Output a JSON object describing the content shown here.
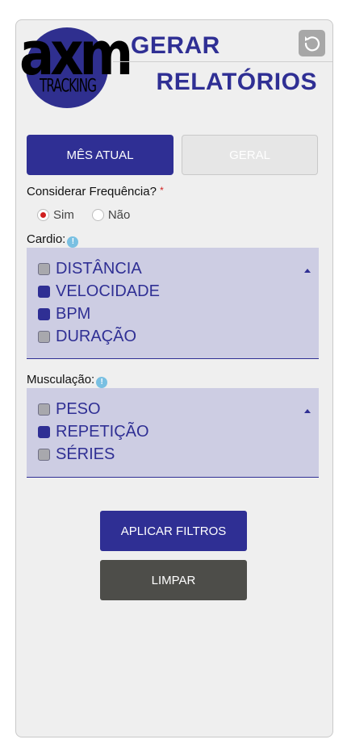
{
  "header": {
    "logo_word": "axm",
    "logo_sub": "TRACKING",
    "title_line1": "GERAR",
    "title_line2": "RELATÓRIOS"
  },
  "tabs": [
    {
      "label": "MÊS ATUAL",
      "active": true
    },
    {
      "label": "GERAL",
      "active": false
    }
  ],
  "frequency": {
    "label": "Considerar Frequência?",
    "required_mark": "*",
    "options": [
      {
        "label": "Sim",
        "selected": true
      },
      {
        "label": "Não",
        "selected": false
      }
    ]
  },
  "cardio": {
    "label": "Cardio:",
    "options": [
      {
        "label": "DISTÂNCIA",
        "checked": false
      },
      {
        "label": "VELOCIDADE",
        "checked": true
      },
      {
        "label": "BPM",
        "checked": true
      },
      {
        "label": "DURAÇÃO",
        "checked": false
      }
    ]
  },
  "musculacao": {
    "label": "Musculação:",
    "options": [
      {
        "label": "PESO",
        "checked": false
      },
      {
        "label": "REPETIÇÃO",
        "checked": true
      },
      {
        "label": "SÉRIES",
        "checked": false
      }
    ]
  },
  "actions": {
    "apply_label": "APLICAR FILTROS",
    "clear_label": "LIMPAR"
  },
  "colors": {
    "primary": "#2f2f94",
    "select_bg": "#cdcde3",
    "clear_button": "#4d4d49",
    "required": "#d21f1f",
    "info": "#79c0e2"
  }
}
